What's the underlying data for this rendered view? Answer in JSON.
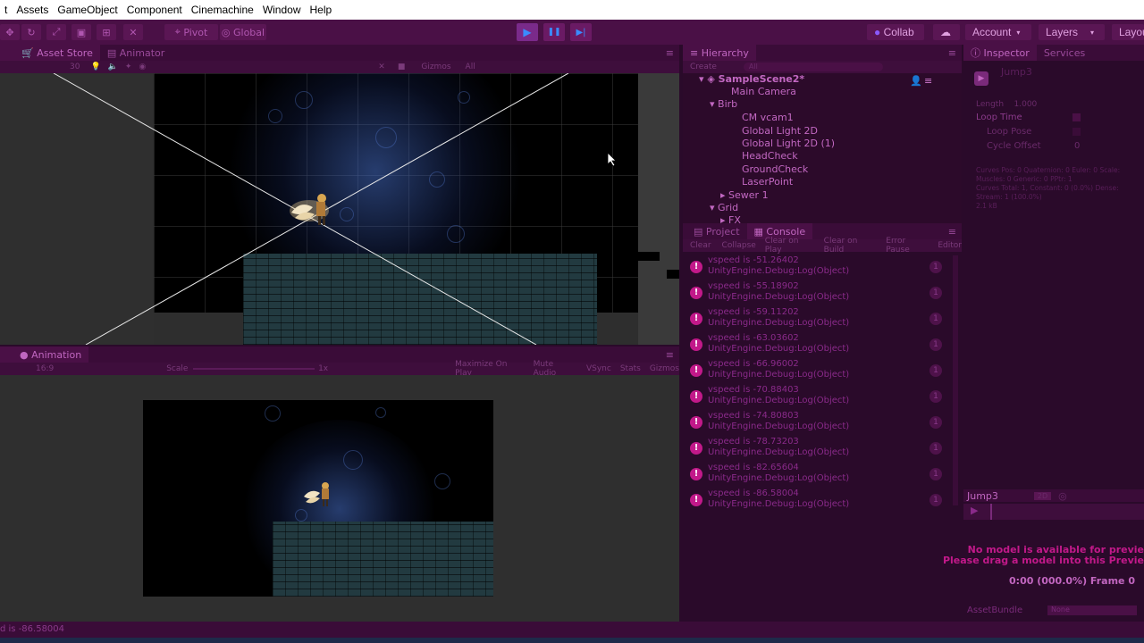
{
  "menu": {
    "items": [
      "t",
      "Assets",
      "GameObject",
      "Component",
      "Cinemachine",
      "Window",
      "Help"
    ]
  },
  "toolbar": {
    "pivot_label": "Pivot",
    "global_label": "Global",
    "collab_label": "Collab",
    "account_label": "Account",
    "layers_label": "Layers",
    "layout_label": "Layou",
    "play_icon": "▶",
    "pause_icon": "❚❚",
    "step_icon": "▶|"
  },
  "scene_panel": {
    "tabs": [
      "Asset Store",
      "Animator"
    ],
    "shaded_label": "30",
    "gizmos_label": "Gizmos",
    "all_label": "All"
  },
  "hierarchy": {
    "tab": "Hierarchy",
    "create_label": "Create",
    "search_label": "All",
    "scene_name": "SampleScene2*",
    "items": [
      "Main Camera",
      "Birb",
      "CM vcam1",
      "Global Light 2D",
      "Global Light 2D (1)",
      "HeadCheck",
      "GroundCheck",
      "LaserPoint",
      "Sewer 1",
      "Grid",
      "FX"
    ]
  },
  "inspector": {
    "tabs": [
      "Inspector",
      "Services"
    ],
    "clip_name": "Jump3",
    "length_label": "Length",
    "length_value": "1.000",
    "loop_time_label": "Loop Time",
    "loop_pose_label": "Loop Pose",
    "cycle_offset_label": "Cycle Offset",
    "cycle_offset_value": "0",
    "stats_lines": [
      "Curves Pos: 0 Quaternion: 0 Euler: 0 Scale:",
      "Muscles: 0 Generic: 0 PPtr: 1",
      "Curves Total: 1, Constant: 0 (0.0%) Dense:",
      "Stream: 1 (100.0%)",
      "2.1 kB"
    ],
    "preview_title": "Jump3",
    "preview_speed": "2D",
    "preview_msg_1": "No model is available for previe",
    "preview_msg_2": "Please drag a model into this Previe",
    "preview_time": "0:00 (000.0%) Frame 0",
    "assetbundle_label": "AssetBundle",
    "assetbundle_value": "None"
  },
  "project_console": {
    "tabs": [
      "Project",
      "Console"
    ],
    "buttons": [
      "Clear",
      "Collapse",
      "Clear on Play",
      "Clear on Build",
      "Error Pause",
      "Editor"
    ],
    "entries": [
      {
        "value": "vspeed is -51.26402",
        "source": "UnityEngine.Debug:Log(Object)",
        "count": "1"
      },
      {
        "value": "vspeed is -55.18902",
        "source": "UnityEngine.Debug:Log(Object)",
        "count": "1"
      },
      {
        "value": "vspeed is -59.11202",
        "source": "UnityEngine.Debug:Log(Object)",
        "count": "1"
      },
      {
        "value": "vspeed is -63.03602",
        "source": "UnityEngine.Debug:Log(Object)",
        "count": "1"
      },
      {
        "value": "vspeed is -66.96002",
        "source": "UnityEngine.Debug:Log(Object)",
        "count": "1"
      },
      {
        "value": "vspeed is -70.88403",
        "source": "UnityEngine.Debug:Log(Object)",
        "count": "1"
      },
      {
        "value": "vspeed is -74.80803",
        "source": "UnityEngine.Debug:Log(Object)",
        "count": "1"
      },
      {
        "value": "vspeed is -78.73203",
        "source": "UnityEngine.Debug:Log(Object)",
        "count": "1"
      },
      {
        "value": "vspeed is -82.65604",
        "source": "UnityEngine.Debug:Log(Object)",
        "count": "1"
      },
      {
        "value": "vspeed is -86.58004",
        "source": "UnityEngine.Debug:Log(Object)",
        "count": "1"
      }
    ]
  },
  "game_panel": {
    "tab": "Animation",
    "aspect": "16:9",
    "scale_label": "Scale",
    "scale_value": "1x",
    "options": [
      "Maximize On Play",
      "Mute Audio",
      "VSync",
      "Stats",
      "Gizmos"
    ]
  },
  "status_bar": {
    "message": "d is -86.58004"
  },
  "colors": {
    "panel": "#2a0a2a",
    "tint": "#d27ad2",
    "console_icon": "#c2198a"
  }
}
